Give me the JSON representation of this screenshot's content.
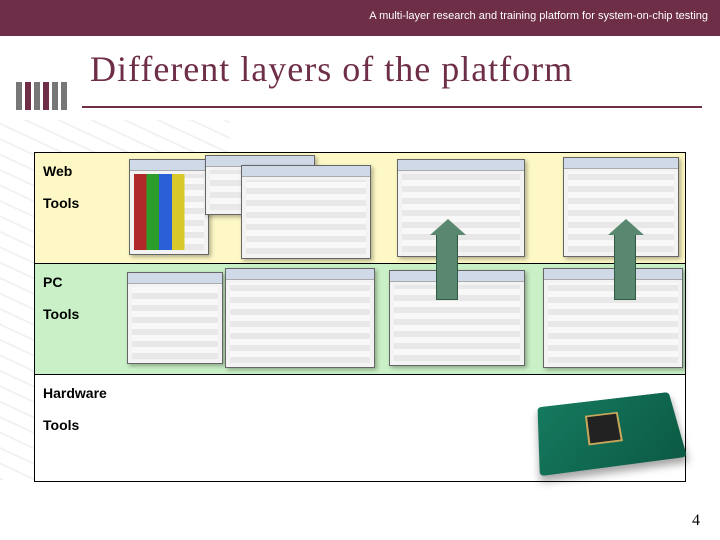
{
  "header": {
    "subtitle": "A multi-layer research and training platform for system-on-chip testing"
  },
  "title": "Different layers of the platform",
  "layers": {
    "web": {
      "label1": "Web",
      "label2": "Tools"
    },
    "pc": {
      "label1": "PC",
      "label2": "Tools"
    },
    "hw": {
      "label1": "Hardware",
      "label2": "Tools"
    }
  },
  "page_number": "4",
  "colors": {
    "accent": "#6e2e47"
  }
}
